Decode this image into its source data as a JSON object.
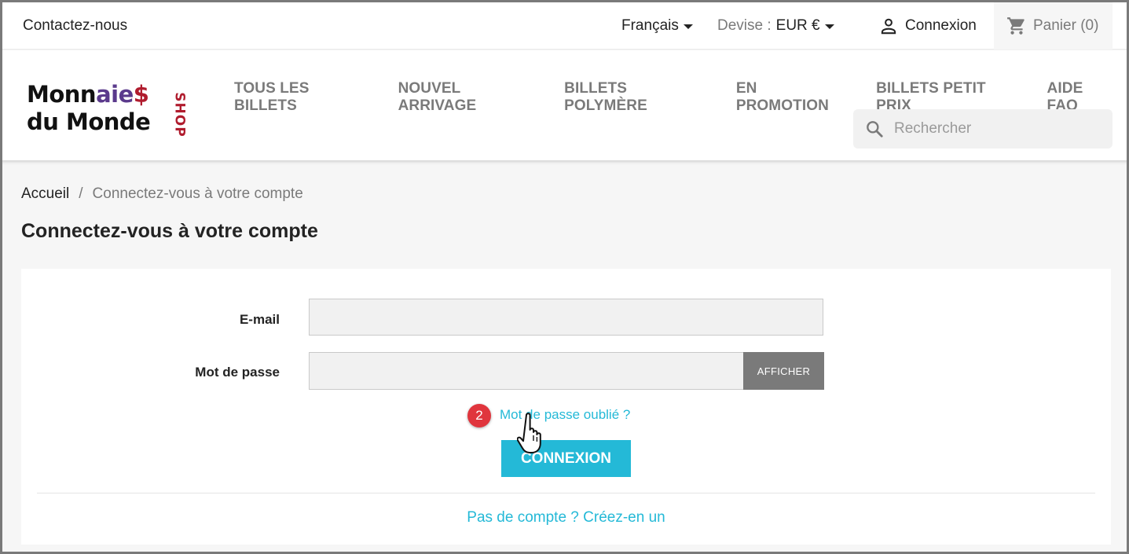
{
  "topbar": {
    "contact": "Contactez-nous",
    "language": "Français",
    "currency_label": "Devise :",
    "currency_value": "EUR €",
    "login": "Connexion",
    "cart": "Panier (0)"
  },
  "logo": {
    "line1_a": "Monn",
    "line1_b": "aie",
    "line1_c": "$",
    "line2": "du Monde",
    "shop": "SHOP"
  },
  "nav": {
    "items": [
      "TOUS LES BILLETS",
      "NOUVEL ARRIVAGE",
      "BILLETS POLYMÈRE",
      "EN PROMOTION",
      "BILLETS PETIT PRIX",
      "AIDE FAQ"
    ]
  },
  "search": {
    "placeholder": "Rechercher"
  },
  "breadcrumb": {
    "home": "Accueil",
    "separator": "/",
    "current": "Connectez-vous à votre compte"
  },
  "page": {
    "title": "Connectez-vous à votre compte"
  },
  "form": {
    "email_label": "E-mail",
    "email_value": "",
    "password_label": "Mot de passe",
    "password_value": "",
    "show_button": "AFFICHER",
    "forgot_link": "Mot de passe oublié ?",
    "step_badge": "2",
    "submit_button": "CONNEXION",
    "register_link": "Pas de compte ? Créez-en un"
  },
  "colors": {
    "accent": "#24b9d7",
    "badge": "#e0353d",
    "text": "#232323",
    "muted": "#7a7a7a"
  }
}
